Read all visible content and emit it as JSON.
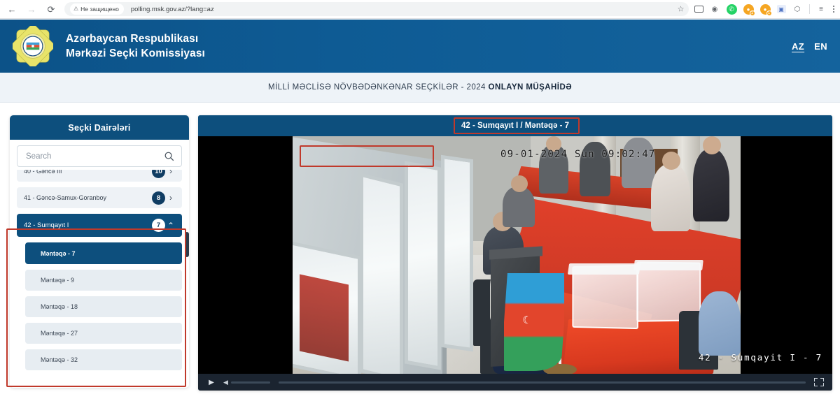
{
  "browser": {
    "back_icon": "arrow-left-icon",
    "forward_icon": "arrow-right-icon",
    "reload_icon": "reload-icon",
    "security_label": "Не защищено",
    "url": "polling.msk.gov.az/?lang=az",
    "bookmark_icon": "star-icon",
    "extensions": [
      {
        "name": "cast-icon",
        "glyph": ""
      },
      {
        "name": "audio-icon",
        "glyph": "◉"
      },
      {
        "name": "whatsapp-icon",
        "glyph": "✆"
      },
      {
        "name": "translate-badge-icon",
        "glyph": "●",
        "badge": "1"
      },
      {
        "name": "notification-badge-icon",
        "glyph": "●",
        "badge": "1"
      },
      {
        "name": "capture-icon",
        "glyph": "▣"
      },
      {
        "name": "extensions-puzzle-icon",
        "glyph": "⬡"
      },
      {
        "name": "reading-list-icon",
        "glyph": "≡"
      },
      {
        "name": "browser-menu-icon",
        "glyph": "⋮"
      }
    ]
  },
  "header": {
    "emblem_name": "cec-azerbaijan-emblem",
    "title_line1": "Azərbaycan Respublikası",
    "title_line2": "Mərkəzi Seçki Komissiyası",
    "languages": [
      {
        "code": "AZ",
        "active": true
      },
      {
        "code": "EN",
        "active": false
      }
    ]
  },
  "banner": {
    "text_normal": "MİLLİ MƏCLİSƏ NÖVBƏDƏNKƏNAR SEÇKİLƏR - 2024 ",
    "text_bold": "ONLAYN MÜŞAHİDƏ"
  },
  "sidebar": {
    "title": "Seçki Dairələri",
    "search": {
      "placeholder": "Search",
      "value": "",
      "icon": "search-icon"
    },
    "districts": [
      {
        "label": "40 - Gəncə III",
        "badge": "10",
        "expanded": false,
        "chevron": "chevron-right-icon"
      },
      {
        "label": "41 - Gəncə-Samux-Goranboy",
        "badge": "8",
        "expanded": false,
        "chevron": "chevron-right-icon"
      },
      {
        "label": "42 - Sumqayıt I",
        "badge": "7",
        "expanded": true,
        "chevron": "chevron-up-icon"
      }
    ],
    "stations": [
      {
        "label": "Məntəqə - 7",
        "active": true
      },
      {
        "label": "Məntəqə - 9",
        "active": false
      },
      {
        "label": "Məntəqə - 18",
        "active": false
      },
      {
        "label": "Məntəqə - 27",
        "active": false
      },
      {
        "label": "Məntəqə - 32",
        "active": false
      }
    ]
  },
  "video": {
    "title": "42 - Sumqayıt I / Məntəqə - 7",
    "timestamp_overlay": "09-01-2024 Sun 09:02:47",
    "watermark": "42 - Sumqayit I - 7",
    "controls": {
      "play_icon": "play-icon",
      "volume_icon": "volume-icon",
      "fullscreen_icon": "fullscreen-icon"
    }
  },
  "annotations": {
    "accent_color": "#c0392b",
    "boxes": [
      "district-group",
      "video-title",
      "video-timestamp"
    ]
  },
  "colors": {
    "brand_blue": "#0d4f7d",
    "header_blue": "#0e5b94",
    "banner_bg": "#eef3f8",
    "badge_navy": "#103d63",
    "annotation_red": "#c0392b"
  }
}
